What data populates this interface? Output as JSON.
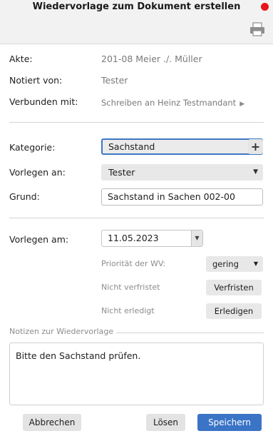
{
  "window": {
    "title": "Wiedervorlage zum Dokument erstellen"
  },
  "info": {
    "akte_label": "Akte:",
    "akte_value": "201-08 Meier ./. Müller",
    "notiert_label": "Notiert von:",
    "notiert_value": "Tester",
    "verbunden_label": "Verbunden mit:",
    "verbunden_value": "Schreiben an Heinz Testmandant"
  },
  "form": {
    "kategorie_label": "Kategorie:",
    "kategorie_value": "Sachstand",
    "vorlegen_an_label": "Vorlegen an:",
    "vorlegen_an_value": "Tester",
    "grund_label": "Grund:",
    "grund_value": "Sachstand in Sachen 002-00"
  },
  "schedule": {
    "vorlegen_am_label": "Vorlegen am:",
    "date_value": "11.05.2023",
    "prioritaet_label": "Priorität der WV:",
    "prioritaet_value": "gering",
    "verfristet_label": "Nicht verfristet",
    "verfristen_button": "Verfristen",
    "erledigt_label": "Nicht erledigt",
    "erledigen_button": "Erledigen"
  },
  "notes": {
    "legend": "Notizen zur Wiedervorlage",
    "text": "Bitte den Sachstand prüfen."
  },
  "footer": {
    "abbrechen": "Abbrechen",
    "loesen": "Lösen",
    "speichern": "Speichern"
  },
  "colors": {
    "accent": "#3a74c6",
    "close": "#e8151b"
  },
  "icons": {
    "print": "printer-icon",
    "close": "close-dot-icon",
    "link_arrow": "triangle-right-icon"
  }
}
